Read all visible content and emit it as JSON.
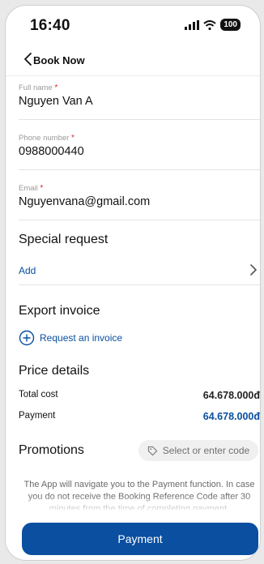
{
  "status_bar": {
    "time": "16:40",
    "battery": "100"
  },
  "header": {
    "title": "Book Now"
  },
  "fields": [
    {
      "label": "Full name",
      "required_mark": "*",
      "value": "Nguyen Van A"
    },
    {
      "label": "Phone number",
      "required_mark": "*",
      "value": "0988000440"
    },
    {
      "label": "Email",
      "required_mark": "*",
      "value": "Nguyenvana@gmail.com"
    }
  ],
  "special_request": {
    "title": "Special request",
    "add_label": "Add"
  },
  "export_invoice": {
    "title": "Export invoice",
    "request_label": "Request an invoice"
  },
  "price_details": {
    "title": "Price details",
    "total_label": "Total cost",
    "total_value": "64.678.000đ",
    "payment_label": "Payment",
    "payment_value": "64.678.000đ"
  },
  "promotions": {
    "title": "Promotions",
    "button_label": "Select or enter code"
  },
  "notice": "The App will navigate you to the Payment function. In case you do not receive the Booking Reference Code after 30 minutes from the time of completing payment,",
  "payment_button": {
    "label": "Payment"
  },
  "colors": {
    "accent": "#0a4fa0",
    "required": "#e0262a"
  }
}
